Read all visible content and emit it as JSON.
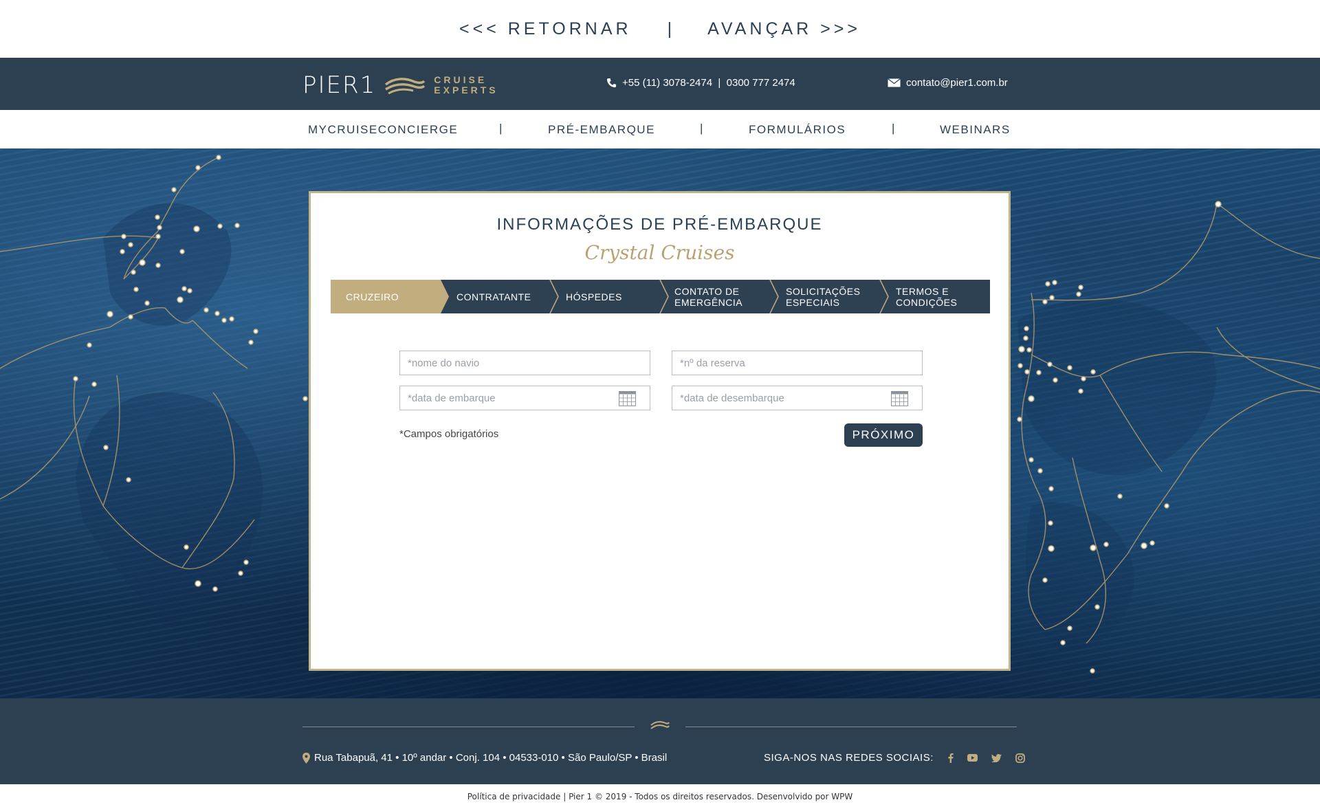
{
  "top_nav": {
    "back_label": "<<< RETORNAR",
    "separator": "|",
    "forward_label": "AVANÇAR >>>"
  },
  "header": {
    "logo_main": "PIER1",
    "logo_sub_line1": "CRUISE",
    "logo_sub_line2": "EXPERTS",
    "phones": "+55 (11) 3078-2474  |  0300 777 2474",
    "email": "contato@pier1.com.br"
  },
  "menu": {
    "items": [
      "MYCRUISECONCIERGE",
      "PRÉ-EMBARQUE",
      "FORMULÁRIOS",
      "WEBINARS"
    ],
    "separator": "|"
  },
  "form": {
    "title": "INFORMAÇÕES DE PRÉ-EMBARQUE",
    "subtitle": "Crystal Cruises",
    "steps": [
      {
        "line1": "CRUZEIRO",
        "line2": ""
      },
      {
        "line1": "CONTRATANTE",
        "line2": ""
      },
      {
        "line1": "HÓSPEDES",
        "line2": ""
      },
      {
        "line1": "CONTATO DE",
        "line2": "EMERGÊNCIA"
      },
      {
        "line1": "SOLICITAÇÕES",
        "line2": "ESPECIAIS"
      },
      {
        "line1": "TERMOS E",
        "line2": "CONDIÇÕES"
      }
    ],
    "active_step": 0,
    "fields": {
      "ship_name_placeholder": "*nome do navio",
      "booking_placeholder": "*nº da reserva",
      "embark_placeholder": "*data de embarque",
      "disembark_placeholder": "*data de desembarque"
    },
    "required_note": "*Campos obrigatórios",
    "next_label": "PRÓXIMO"
  },
  "footer": {
    "address": "Rua Tabapuã, 41 • 10º andar • Conj. 104 • 04533-010 • São Paulo/SP • Brasil",
    "social_label": "SIGA-NOS NAS REDES SOCIAIS:",
    "social_icons": [
      "facebook-icon",
      "youtube-icon",
      "twitter-icon",
      "instagram-icon"
    ],
    "legal": "Política de privacidade | Pier 1 © 2019 - Todos os direitos reservados. Desenvolvido por WPW"
  },
  "colors": {
    "navy": "#2c4052",
    "gold": "#c2ad7e",
    "gold_text": "#b9a272"
  }
}
